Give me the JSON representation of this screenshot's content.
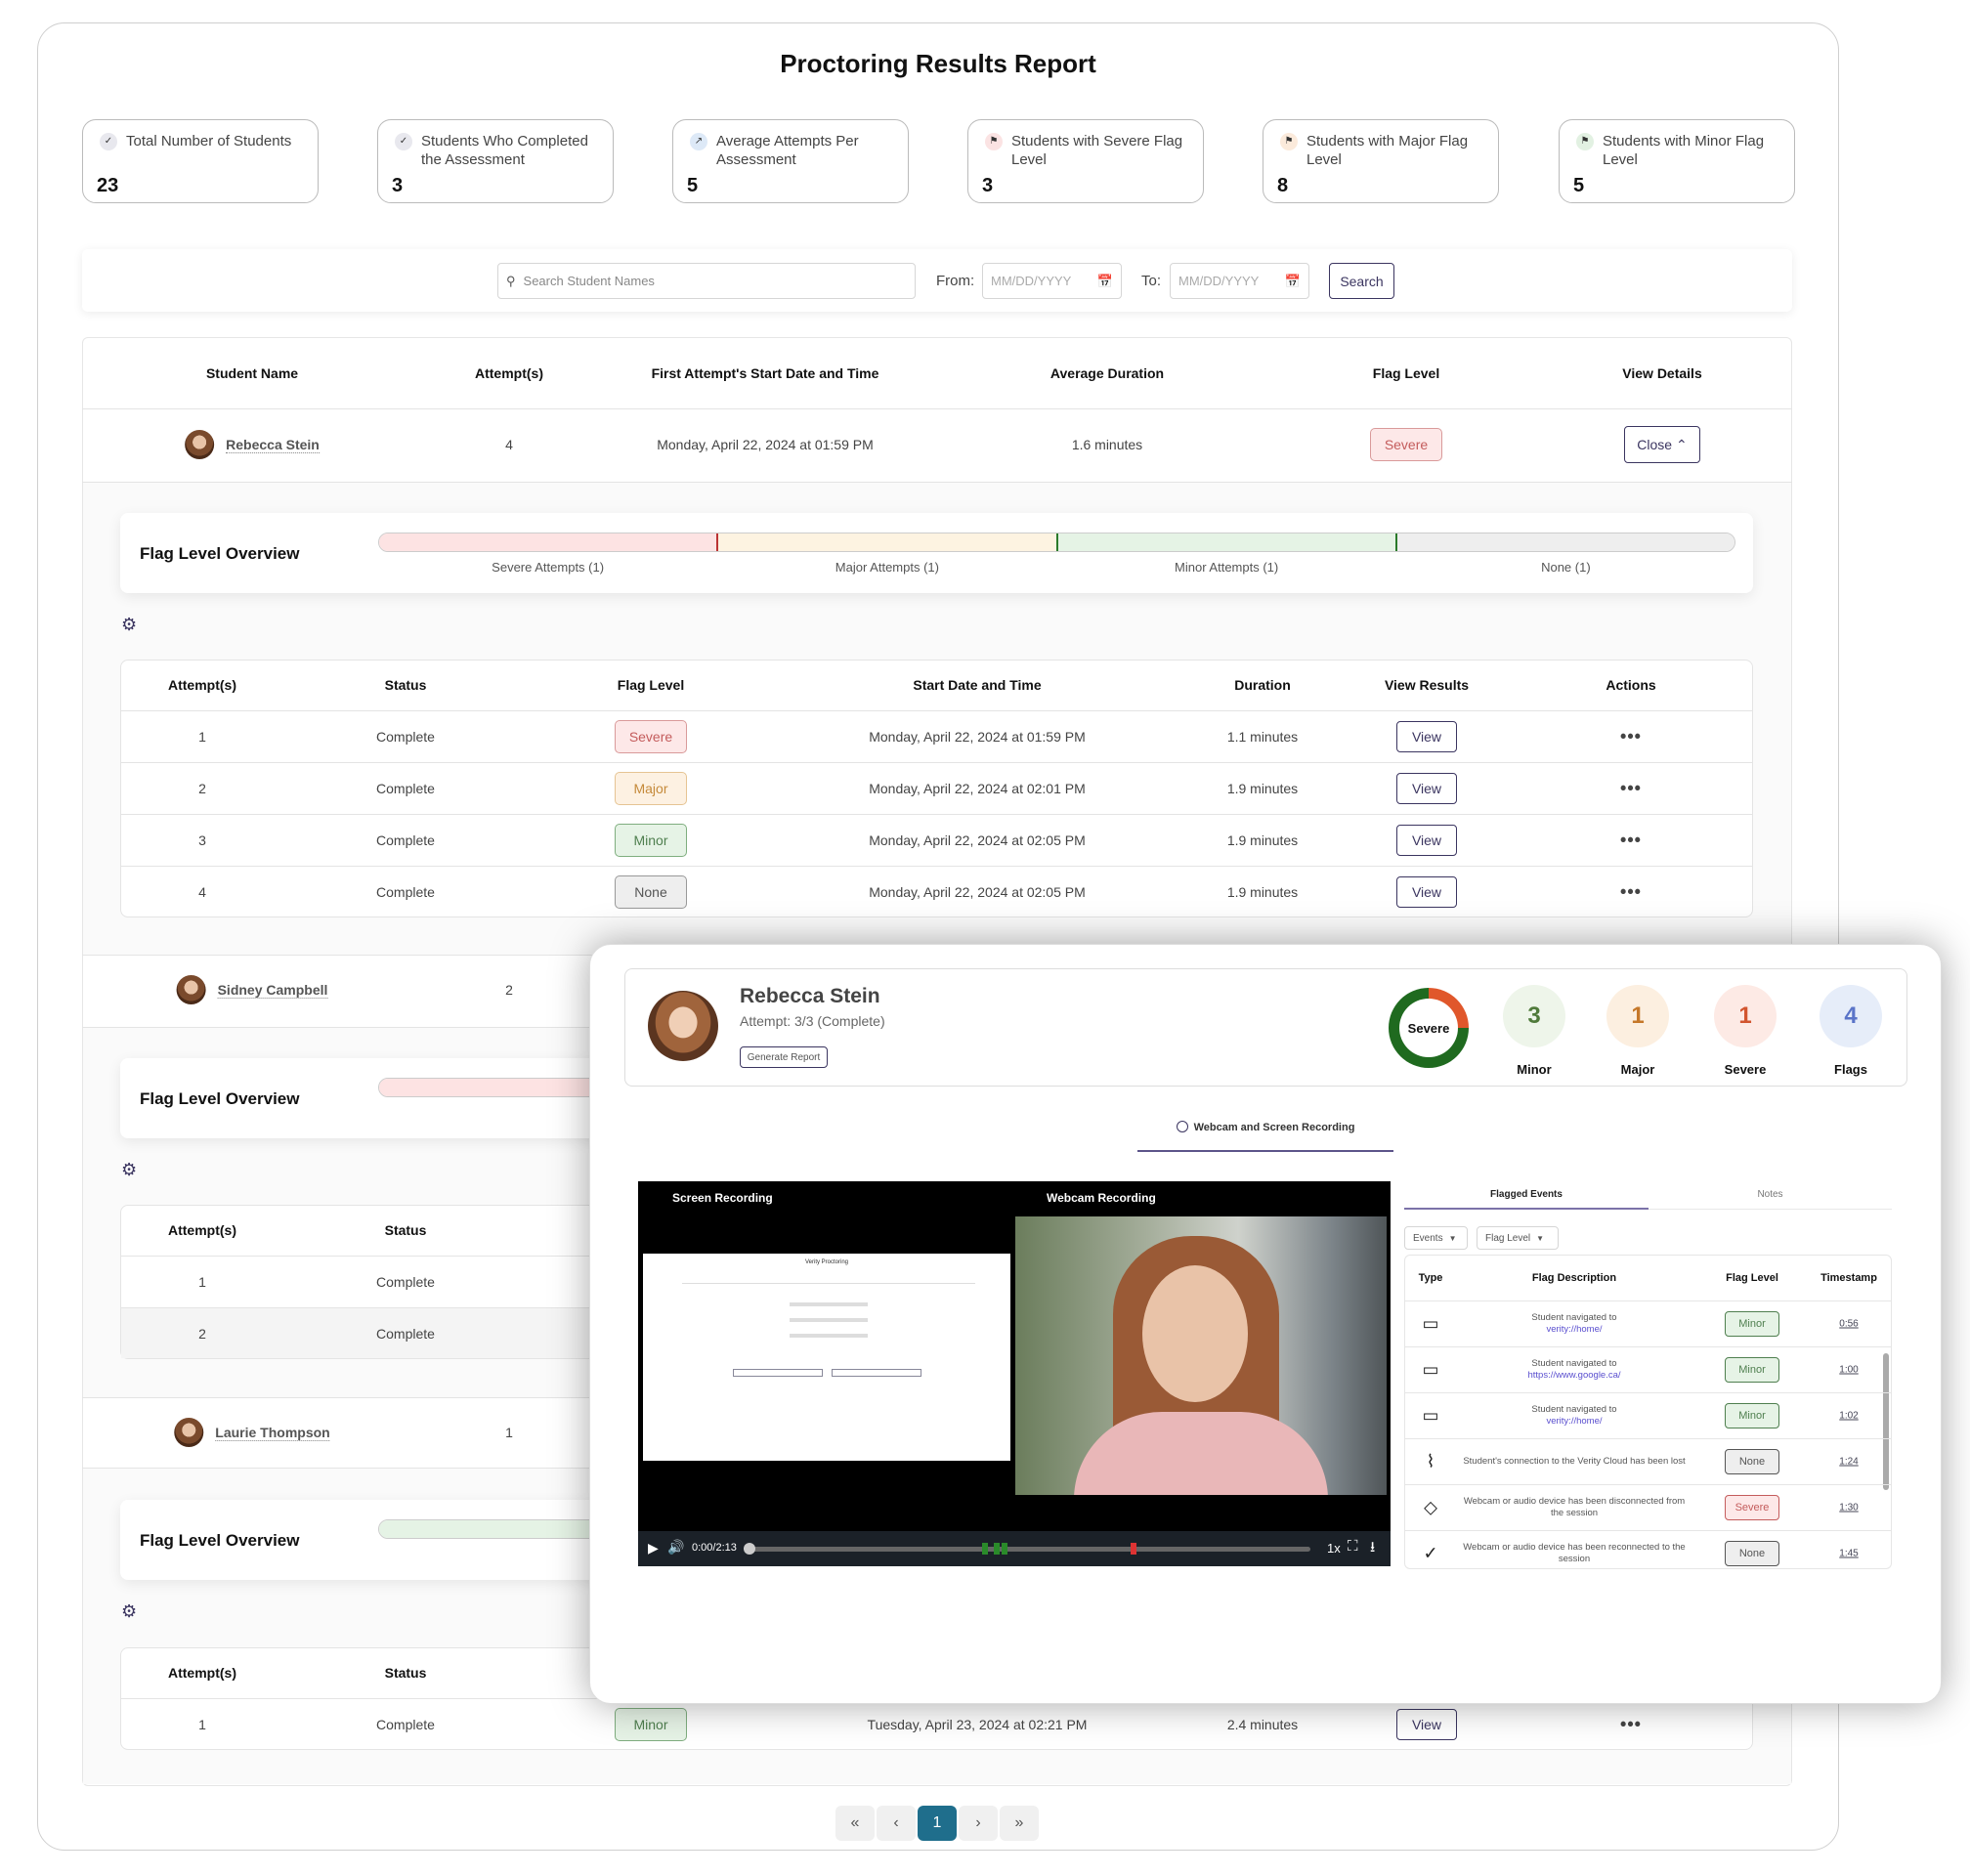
{
  "title": "Proctoring Results Report",
  "stats": [
    {
      "label": "Total Number of Students",
      "value": "23",
      "icon": "check-circle-icon",
      "color": "#e8e8ee"
    },
    {
      "label": "Students Who Completed the Assessment",
      "value": "3",
      "icon": "check-circle-icon",
      "color": "#e8e8ee"
    },
    {
      "label": "Average Attempts Per Assessment",
      "value": "5",
      "icon": "trend-icon",
      "color": "#dde9f7"
    },
    {
      "label": "Students with Severe Flag Level",
      "value": "3",
      "icon": "flag-icon",
      "color": "#fbe3e3"
    },
    {
      "label": "Students with Major Flag Level",
      "value": "8",
      "icon": "flag-icon",
      "color": "#fbeadb"
    },
    {
      "label": "Students with Minor Flag Level",
      "value": "5",
      "icon": "flag-icon",
      "color": "#e2f1e2"
    }
  ],
  "search": {
    "placeholder": "Search Student Names",
    "from_label": "From:",
    "to_label": "To:",
    "date_placeholder": "MM/DD/YYYY",
    "button": "Search"
  },
  "main_headers": [
    "Student Name",
    "Attempt(s)",
    "First Attempt's Start Date and Time",
    "Average Duration",
    "Flag Level",
    "View Details"
  ],
  "students": [
    {
      "name": "Rebecca Stein",
      "attempts": "4",
      "start": "Monday, April 22, 2024 at 01:59 PM",
      "duration": "1.6 minutes",
      "flag": "Severe",
      "action": "Close"
    },
    {
      "name": "Sidney Campbell",
      "attempts": "2"
    },
    {
      "name": "Laurie Thompson",
      "attempts": "1"
    }
  ],
  "overview_title": "Flag Level Overview",
  "overview_segments": [
    {
      "label": "Severe Attempts (1)",
      "color": "#fde3e3"
    },
    {
      "label": "Major Attempts (1)",
      "color": "#fdf3e1"
    },
    {
      "label": "Minor Attempts (1)",
      "color": "#e5f3e5"
    },
    {
      "label": "None (1)",
      "color": "#eeeeee"
    }
  ],
  "attempt_headers": [
    "Attempt(s)",
    "Status",
    "Flag Level",
    "Start Date and Time",
    "Duration",
    "View Results",
    "Actions"
  ],
  "rebecca_attempts": [
    {
      "n": "1",
      "status": "Complete",
      "flag": "Severe",
      "start": "Monday, April 22, 2024 at 01:59 PM",
      "duration": "1.1 minutes",
      "view": "View"
    },
    {
      "n": "2",
      "status": "Complete",
      "flag": "Major",
      "start": "Monday, April 22, 2024 at 02:01 PM",
      "duration": "1.9 minutes",
      "view": "View"
    },
    {
      "n": "3",
      "status": "Complete",
      "flag": "Minor",
      "start": "Monday, April 22, 2024 at 02:05 PM",
      "duration": "1.9 minutes",
      "view": "View"
    },
    {
      "n": "4",
      "status": "Complete",
      "flag": "None",
      "start": "Monday, April 22, 2024 at 02:05 PM",
      "duration": "1.9 minutes",
      "view": "View"
    }
  ],
  "sidney_attempts": [
    {
      "n": "1",
      "status": "Complete"
    },
    {
      "n": "2",
      "status": "Complete"
    }
  ],
  "laurie_attempts": [
    {
      "n": "1",
      "status": "Complete",
      "flag": "Minor",
      "start": "Tuesday, April 23, 2024 at 02:21 PM",
      "duration": "2.4 minutes",
      "view": "View"
    }
  ],
  "pagination": {
    "first": "«",
    "prev": "‹",
    "current": "1",
    "next": "›",
    "last": "»",
    "active_color": "#1f6e8c"
  },
  "modal": {
    "name": "Rebecca Stein",
    "attempt": "Attempt: 3/3 (Complete)",
    "generate": "Generate Report",
    "donut_label": "Severe",
    "counts": [
      {
        "value": "3",
        "label": "Minor",
        "bg": "#eef5ea",
        "fg": "#4f7a3a"
      },
      {
        "value": "1",
        "label": "Major",
        "bg": "#fcefe0",
        "fg": "#c5782a"
      },
      {
        "value": "1",
        "label": "Severe",
        "bg": "#fdeae5",
        "fg": "#d2552f"
      },
      {
        "value": "4",
        "label": "Flags",
        "bg": "#e6edf9",
        "fg": "#5a74c8"
      }
    ],
    "tab": "Webcam and Screen Recording",
    "screen_label": "Screen Recording",
    "webcam_label": "Webcam Recording",
    "screen_app": "Verity Proctoring",
    "time": "0:00/2:13",
    "speed": "1x",
    "side_tabs": [
      "Flagged Events",
      "Notes"
    ],
    "filters": [
      "Events",
      "Flag Level"
    ],
    "event_headers": [
      "Type",
      "Flag Description",
      "Flag Level",
      "Timestamp"
    ],
    "events": [
      {
        "icon": "browser-window-icon",
        "text": "Student navigated to",
        "link": "verity://home/",
        "flag": "Minor",
        "time": "0:56"
      },
      {
        "icon": "browser-window-icon",
        "text": "Student navigated to",
        "link": "https://www.google.ca/",
        "flag": "Minor",
        "time": "1:00"
      },
      {
        "icon": "browser-window-icon",
        "text": "Student navigated to",
        "link": "verity://home/",
        "flag": "Minor",
        "time": "1:02"
      },
      {
        "icon": "wifi-off-icon",
        "text": "Student's connection to the Verity Cloud has been lost",
        "link": "",
        "flag": "None",
        "time": "1:24"
      },
      {
        "icon": "warning-diamond-icon",
        "text": "Webcam or audio device has been disconnected from the session",
        "link": "",
        "flag": "Severe",
        "time": "1:30"
      },
      {
        "icon": "check-circle-icon",
        "text": "Webcam or audio device has been reconnected to the session",
        "link": "",
        "flag": "None",
        "time": "1:45"
      }
    ]
  }
}
